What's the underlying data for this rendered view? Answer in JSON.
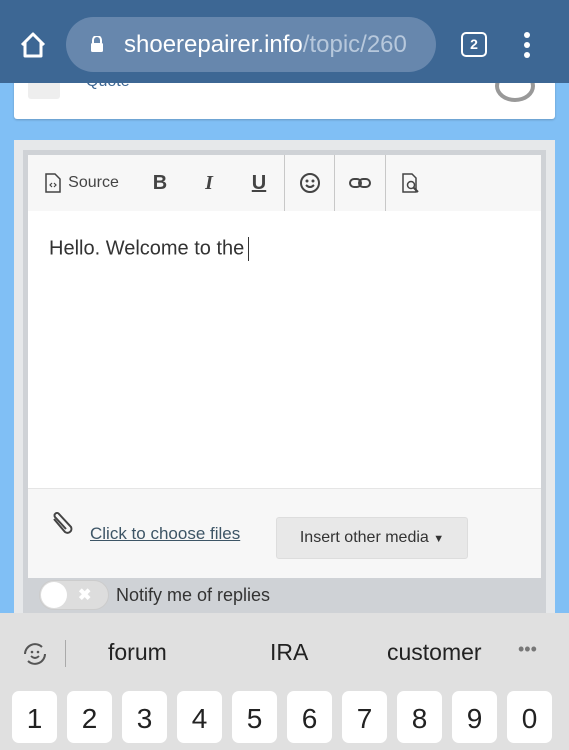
{
  "browser": {
    "url_host": "shoerepairer.info",
    "url_path": "/topic/260",
    "tab_count": "2"
  },
  "quote": {
    "label": "Quote"
  },
  "toolbar": {
    "source": "Source",
    "bold": "B",
    "italic": "I",
    "underline": "U"
  },
  "editor": {
    "text": "Hello. Welcome to the"
  },
  "attachments": {
    "choose_files": "Click to choose files",
    "insert_media": "Insert other media"
  },
  "notify": {
    "label": "Notify me of replies",
    "enabled": false
  },
  "keyboard": {
    "suggestions": [
      "forum",
      "IRA",
      "customer"
    ],
    "keys": [
      "1",
      "2",
      "3",
      "4",
      "5",
      "6",
      "7",
      "8",
      "9",
      "0"
    ]
  }
}
